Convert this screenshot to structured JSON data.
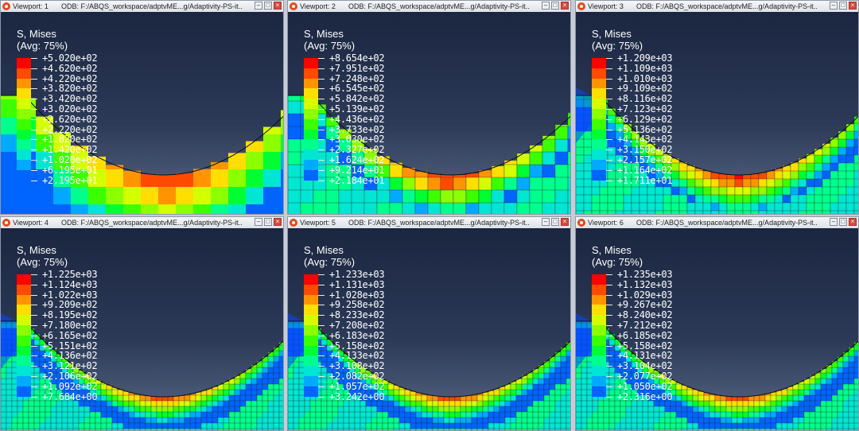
{
  "viewports": [
    {
      "name": "Viewport: 1",
      "odb": "ODB: F:/ABQS_workspace/adptvME...g/Adaptivity-PS-it...",
      "title": "S, Mises",
      "subtitle": "(Avg: 75%)",
      "values": [
        "+5.020e+02",
        "+4.620e+02",
        "+4.220e+02",
        "+3.820e+02",
        "+3.420e+02",
        "+3.020e+02",
        "+2.620e+02",
        "+2.220e+02",
        "+1.820e+02",
        "+1.420e+02",
        "+1.020e+02",
        "+6.195e+01",
        "+2.195e+01"
      ]
    },
    {
      "name": "Viewport: 2",
      "odb": "ODB: F:/ABQS_workspace/adptvME...g/Adaptivity-PS-it...",
      "title": "S, Mises",
      "subtitle": "(Avg: 75%)",
      "values": [
        "+8.654e+02",
        "+7.951e+02",
        "+7.248e+02",
        "+6.545e+02",
        "+5.842e+02",
        "+5.139e+02",
        "+4.436e+02",
        "+3.733e+02",
        "+3.030e+02",
        "+2.327e+02",
        "+1.624e+02",
        "+9.214e+01",
        "+2.184e+01"
      ]
    },
    {
      "name": "Viewport: 3",
      "odb": "ODB: F:/ABQS_workspace/adptvME...g/Adaptivity-PS-it...",
      "title": "S, Mises",
      "subtitle": "(Avg: 75%)",
      "values": [
        "+1.209e+03",
        "+1.109e+03",
        "+1.010e+03",
        "+9.109e+02",
        "+8.116e+02",
        "+7.123e+02",
        "+6.129e+02",
        "+5.136e+02",
        "+4.143e+02",
        "+3.150e+02",
        "+2.157e+02",
        "+1.164e+02",
        "+1.711e+01"
      ]
    },
    {
      "name": "Viewport: 4",
      "odb": "ODB: F:/ABQS_workspace/adptvME...g/Adaptivity-PS-it...",
      "title": "S, Mises",
      "subtitle": "(Avg: 75%)",
      "values": [
        "+1.225e+03",
        "+1.124e+03",
        "+1.022e+03",
        "+9.209e+02",
        "+8.195e+02",
        "+7.180e+02",
        "+6.165e+02",
        "+5.151e+02",
        "+4.136e+02",
        "+3.121e+02",
        "+2.106e+02",
        "+1.092e+02",
        "+7.684e+00"
      ]
    },
    {
      "name": "Viewport: 5",
      "odb": "ODB: F:/ABQS_workspace/adptvME...g/Adaptivity-PS-it...",
      "title": "S, Mises",
      "subtitle": "(Avg: 75%)",
      "values": [
        "+1.233e+03",
        "+1.131e+03",
        "+1.028e+03",
        "+9.258e+02",
        "+8.233e+02",
        "+7.208e+02",
        "+6.183e+02",
        "+5.158e+02",
        "+4.133e+02",
        "+3.108e+02",
        "+2.082e+02",
        "+1.057e+02",
        "+3.242e+00"
      ]
    },
    {
      "name": "Viewport: 6",
      "odb": "ODB: F:/ABQS_workspace/adptvME...g/Adaptivity-PS-it...",
      "title": "S, Mises",
      "subtitle": "(Avg: 75%)",
      "values": [
        "+1.235e+03",
        "+1.132e+03",
        "+1.029e+03",
        "+9.267e+02",
        "+8.240e+02",
        "+7.212e+02",
        "+6.185e+02",
        "+5.158e+02",
        "+4.131e+02",
        "+3.104e+02",
        "+2.077e+02",
        "+1.050e+02",
        "+2.316e+00"
      ]
    }
  ],
  "legend_colors": [
    "#ff0000",
    "#ff4a00",
    "#ff9400",
    "#ffde00",
    "#d4ff00",
    "#8cff00",
    "#3cff00",
    "#00ff32",
    "#00ff8c",
    "#00e6d2",
    "#00aaff",
    "#0064ff",
    "#0000ff"
  ],
  "icons": {
    "viewport": "viewport-icon",
    "minimize": "minimize-icon",
    "maximize": "maximize-icon",
    "close": "close-icon"
  },
  "window_buttons": {
    "minimize": "–",
    "maximize": "□",
    "close": "×"
  }
}
